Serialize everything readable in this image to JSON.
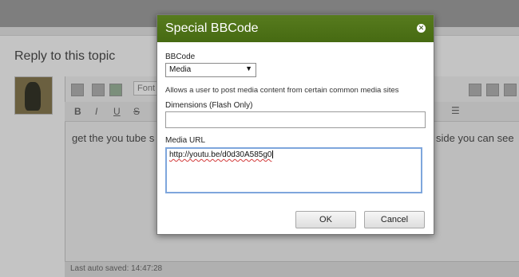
{
  "background": {
    "section_title": "Reply to this topic",
    "toolbar_font_label": "Font",
    "editor_text_left": "get the you tube s",
    "editor_text_right": "side you can see",
    "autosave_text": "Last auto saved: 14:47:28",
    "format_buttons": [
      "B",
      "I",
      "U",
      "S"
    ]
  },
  "dialog": {
    "title": "Special BBCode",
    "close_icon": "close-icon",
    "bbcode_label": "BBCode",
    "bbcode_value": "Media",
    "description": "Allows a user to post media content from certain common media sites",
    "dimensions_label": "Dimensions (Flash Only)",
    "dimensions_value": "",
    "media_url_label": "Media URL",
    "media_url_value": "http://youtu.be/d0d30A585g0",
    "ok_label": "OK",
    "cancel_label": "Cancel",
    "header_color": "#4f7419"
  }
}
